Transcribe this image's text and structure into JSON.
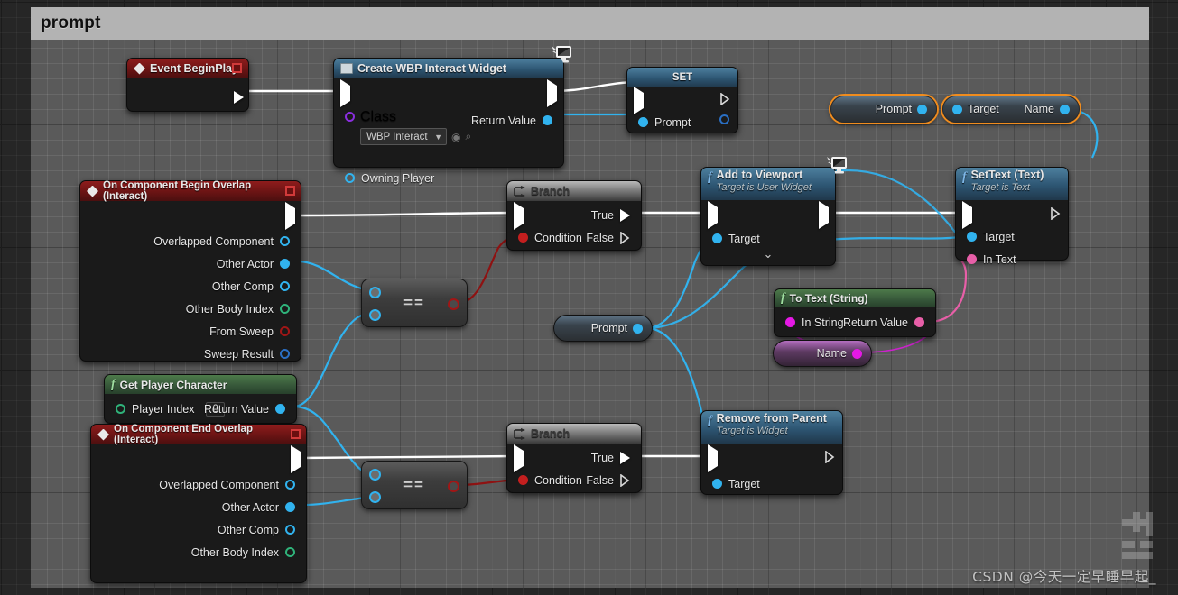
{
  "comment": {
    "title": "prompt"
  },
  "watermark": {
    "text": "CSDN @今天一定早睡早起_"
  },
  "nodes": {
    "event_begin_play": {
      "title": "Event BeginPlay",
      "icon": "event-diamond-icon",
      "badge": "delete-pin-icon"
    },
    "create_widget": {
      "title": "Create WBP Interact Widget",
      "icon": "widget-icon",
      "badge": "replicates-monitor-icon",
      "pins": {
        "class_label": "Class",
        "class_value": "WBP Interact",
        "owning_player": "Owning Player",
        "return_value": "Return Value"
      }
    },
    "set_prompt": {
      "title": "SET",
      "pins": {
        "prompt": "Prompt"
      }
    },
    "get_prompt_var": {
      "label": "Prompt"
    },
    "get_target_name": {
      "target_label": "Target",
      "name_label": "Name"
    },
    "on_begin_overlap": {
      "title": "On Component Begin Overlap (Interact)",
      "icon": "event-diamond-icon",
      "badge": "delete-pin-icon",
      "pins": [
        "Overlapped Component",
        "Other Actor",
        "Other Comp",
        "Other Body Index",
        "From Sweep",
        "Sweep Result"
      ]
    },
    "equals_top": {
      "operator": "=="
    },
    "equals_bottom": {
      "operator": "=="
    },
    "branch_top": {
      "title": "Branch",
      "icon": "branch-icon",
      "pins": {
        "condition": "Condition",
        "true": "True",
        "false": "False"
      }
    },
    "branch_bottom": {
      "title": "Branch",
      "icon": "branch-icon",
      "pins": {
        "condition": "Condition",
        "true": "True",
        "false": "False"
      }
    },
    "prompt_middle": {
      "label": "Prompt"
    },
    "add_to_viewport": {
      "title": "Add to Viewport",
      "subtitle": "Target is User Widget",
      "icon": "function-f-icon",
      "badge": "replicates-monitor-icon",
      "pins": {
        "target": "Target"
      },
      "expander": "chevron-down-icon"
    },
    "set_text": {
      "title": "SetText (Text)",
      "subtitle": "Target is Text",
      "icon": "function-f-icon",
      "pins": {
        "target": "Target",
        "in_text": "In Text"
      }
    },
    "to_text_string": {
      "title": "To Text (String)",
      "icon": "function-f-icon",
      "pins": {
        "in_string": "In String",
        "return_value": "Return Value"
      }
    },
    "name_var": {
      "label": "Name"
    },
    "get_player_character": {
      "title": "Get Player Character",
      "icon": "function-f-icon",
      "pins": {
        "player_index": "Player Index",
        "player_index_value": "0",
        "return_value": "Return Value"
      }
    },
    "on_end_overlap": {
      "title": "On Component End Overlap (Interact)",
      "icon": "event-diamond-icon",
      "badge": "delete-pin-icon",
      "pins": [
        "Overlapped Component",
        "Other Actor",
        "Other Comp",
        "Other Body Index"
      ]
    },
    "remove_from_parent": {
      "title": "Remove from Parent",
      "subtitle": "Target is Widget",
      "icon": "function-f-icon",
      "pins": {
        "target": "Target"
      }
    }
  },
  "colors": {
    "exec_white": "#ffffff",
    "object_blue": "#31b3ef",
    "bool_red": "#a01616",
    "int_green": "#2fb37a",
    "struct_darkblue": "#2a6fc4",
    "class_purple": "#8b2ee0",
    "text_pink": "#e85fa8",
    "name_magenta": "#e519e5",
    "selection_orange": "#f08c1e",
    "event_header": "#6a1414",
    "function_header": "#2d5572",
    "pure_header": "#37583a"
  }
}
